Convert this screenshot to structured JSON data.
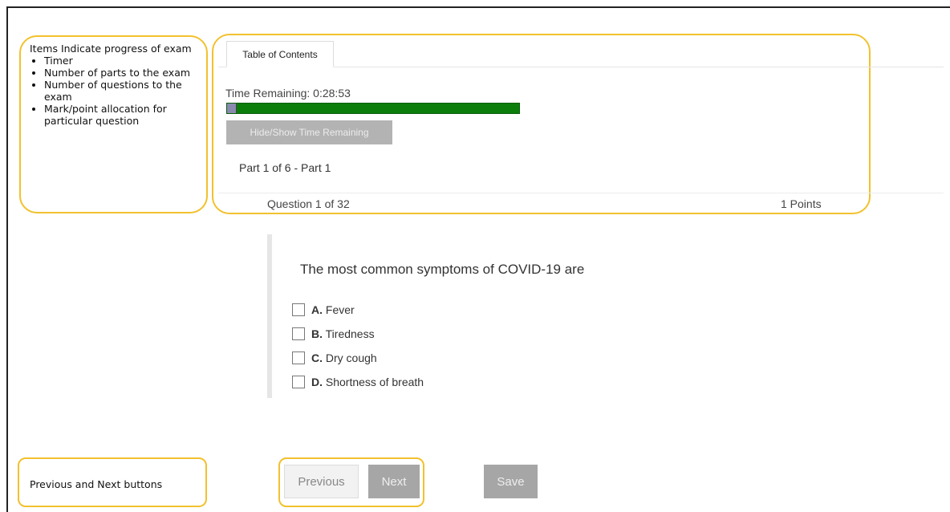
{
  "annotations": {
    "progress_note": {
      "heading": "Items Indicate progress of exam",
      "bullets": [
        "Timer",
        "Number of parts to the exam",
        "Number of questions to the exam",
        "Mark/point allocation for particular  question"
      ]
    },
    "nav_note": "Previous and Next buttons",
    "highlight_color": "#f2c12e"
  },
  "tabs": [
    "Table of Contents"
  ],
  "timer": {
    "label": "Time Remaining: 0:28:53",
    "remaining_fraction": 0.97,
    "bar_color": "#0b7d0b"
  },
  "hide_show_button": "Hide/Show Time Remaining",
  "part_label": "Part 1 of 6 - Part 1",
  "question_bar": {
    "count": "Question 1 of 32",
    "points": "1 Points"
  },
  "question": {
    "text": "The most common symptoms of COVID-19 are",
    "options": [
      {
        "letter": "A.",
        "text": "Fever"
      },
      {
        "letter": "B.",
        "text": "Tiredness"
      },
      {
        "letter": "C.",
        "text": "Dry cough"
      },
      {
        "letter": "D.",
        "text": "Shortness of breath"
      }
    ]
  },
  "buttons": {
    "previous": "Previous",
    "next": "Next",
    "save": "Save"
  }
}
